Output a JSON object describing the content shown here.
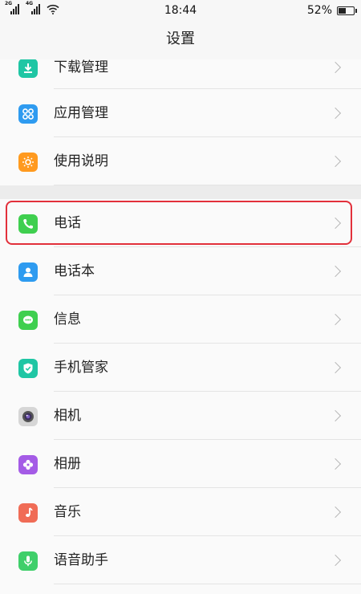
{
  "status_bar": {
    "network_1": "2G",
    "network_2": "4G",
    "time": "18:44",
    "battery_percent": "52%",
    "battery_level": 0.52
  },
  "header": {
    "title": "设置"
  },
  "section_1": {
    "items": [
      {
        "label": "下载管理",
        "icon": "download-icon",
        "color": "#1fc6a4"
      },
      {
        "label": "应用管理",
        "icon": "apps-icon",
        "color": "#2e9bf0"
      },
      {
        "label": "使用说明",
        "icon": "bulb-icon",
        "color": "#ff9a1f"
      }
    ]
  },
  "section_2": {
    "items": [
      {
        "label": "电话",
        "icon": "phone-icon",
        "color": "#3fcf4f"
      },
      {
        "label": "电话本",
        "icon": "contacts-icon",
        "color": "#2e9bf0"
      },
      {
        "label": "信息",
        "icon": "message-icon",
        "color": "#3fcf4f"
      },
      {
        "label": "手机管家",
        "icon": "shield-icon",
        "color": "#1fc6a4"
      },
      {
        "label": "相机",
        "icon": "camera-icon",
        "color": "#d6d6d6"
      },
      {
        "label": "相册",
        "icon": "gallery-icon",
        "color": "#a45be6"
      },
      {
        "label": "音乐",
        "icon": "music-icon",
        "color": "#f06c56"
      },
      {
        "label": "语音助手",
        "icon": "mic-icon",
        "color": "#3fcf6a"
      }
    ]
  },
  "highlight_color": "#e2303b"
}
